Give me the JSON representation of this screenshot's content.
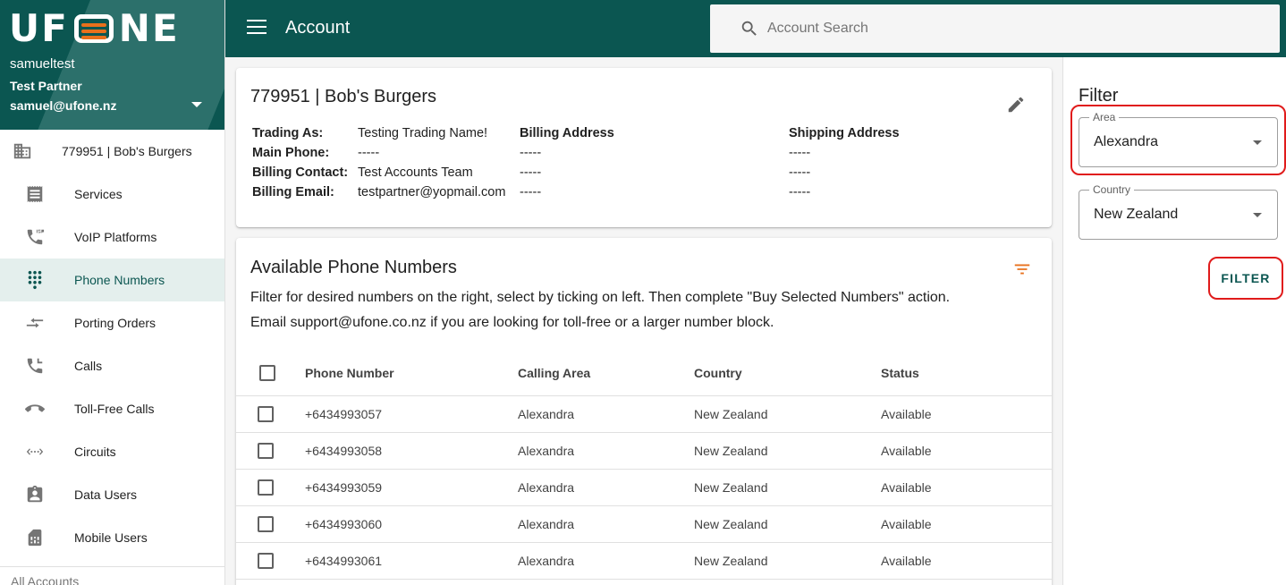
{
  "brand": {
    "logo_text": "UFONE",
    "username": "samueltest",
    "partner": "Test Partner",
    "email": "samuel@ufone.nz"
  },
  "sidebar": {
    "account_item": {
      "label": "779951 | Bob's Burgers",
      "icon": "building-icon"
    },
    "items": [
      {
        "label": "Services",
        "icon": "receipt-icon"
      },
      {
        "label": "VoIP Platforms",
        "icon": "sip-phone-icon"
      },
      {
        "label": "Phone Numbers",
        "icon": "dialpad-icon",
        "active": true
      },
      {
        "label": "Porting Orders",
        "icon": "arrows-icon"
      },
      {
        "label": "Calls",
        "icon": "phone-callback-icon"
      },
      {
        "label": "Toll-Free Calls",
        "icon": "call-end-icon"
      },
      {
        "label": "Circuits",
        "icon": "code-arrows-icon"
      },
      {
        "label": "Data Users",
        "icon": "assignment-ind-icon"
      },
      {
        "label": "Mobile Users",
        "icon": "sim-card-icon"
      }
    ],
    "footer_label": "All Accounts"
  },
  "header": {
    "title": "Account",
    "search_placeholder": "Account Search"
  },
  "account_card": {
    "title": "779951 | Bob's Burgers",
    "rows": [
      {
        "label": "Trading As:",
        "value": "Testing Trading Name!",
        "billing": "Billing Address",
        "shipping": "Shipping Address"
      },
      {
        "label": "Main Phone:",
        "value": "-----",
        "billing": "-----",
        "shipping": "-----"
      },
      {
        "label": "Billing Contact:",
        "value": "Test Accounts Team",
        "billing": "-----",
        "shipping": "-----"
      },
      {
        "label": "Billing Email:",
        "value": "testpartner@yopmail.com",
        "billing": "-----",
        "shipping": "-----"
      }
    ]
  },
  "numbers_card": {
    "title": "Available Phone Numbers",
    "desc_line1": "Filter for desired numbers on the right, select by ticking on left. Then complete \"Buy Selected Numbers\" action.",
    "desc_line2": "Email support@ufone.co.nz if you are looking for toll-free or a larger number block.",
    "columns": [
      "Phone Number",
      "Calling Area",
      "Country",
      "Status"
    ],
    "rows": [
      [
        "+6434993057",
        "Alexandra",
        "New Zealand",
        "Available"
      ],
      [
        "+6434993058",
        "Alexandra",
        "New Zealand",
        "Available"
      ],
      [
        "+6434993059",
        "Alexandra",
        "New Zealand",
        "Available"
      ],
      [
        "+6434993060",
        "Alexandra",
        "New Zealand",
        "Available"
      ],
      [
        "+6434993061",
        "Alexandra",
        "New Zealand",
        "Available"
      ]
    ]
  },
  "filter_panel": {
    "title": "Filter",
    "area": {
      "label": "Area",
      "value": "Alexandra"
    },
    "country": {
      "label": "Country",
      "value": "New Zealand"
    },
    "button_label": "FILTER"
  },
  "colors": {
    "brand_teal": "#0b5651",
    "accent_orange": "#e8701c",
    "highlight_red": "#e01b1b"
  }
}
